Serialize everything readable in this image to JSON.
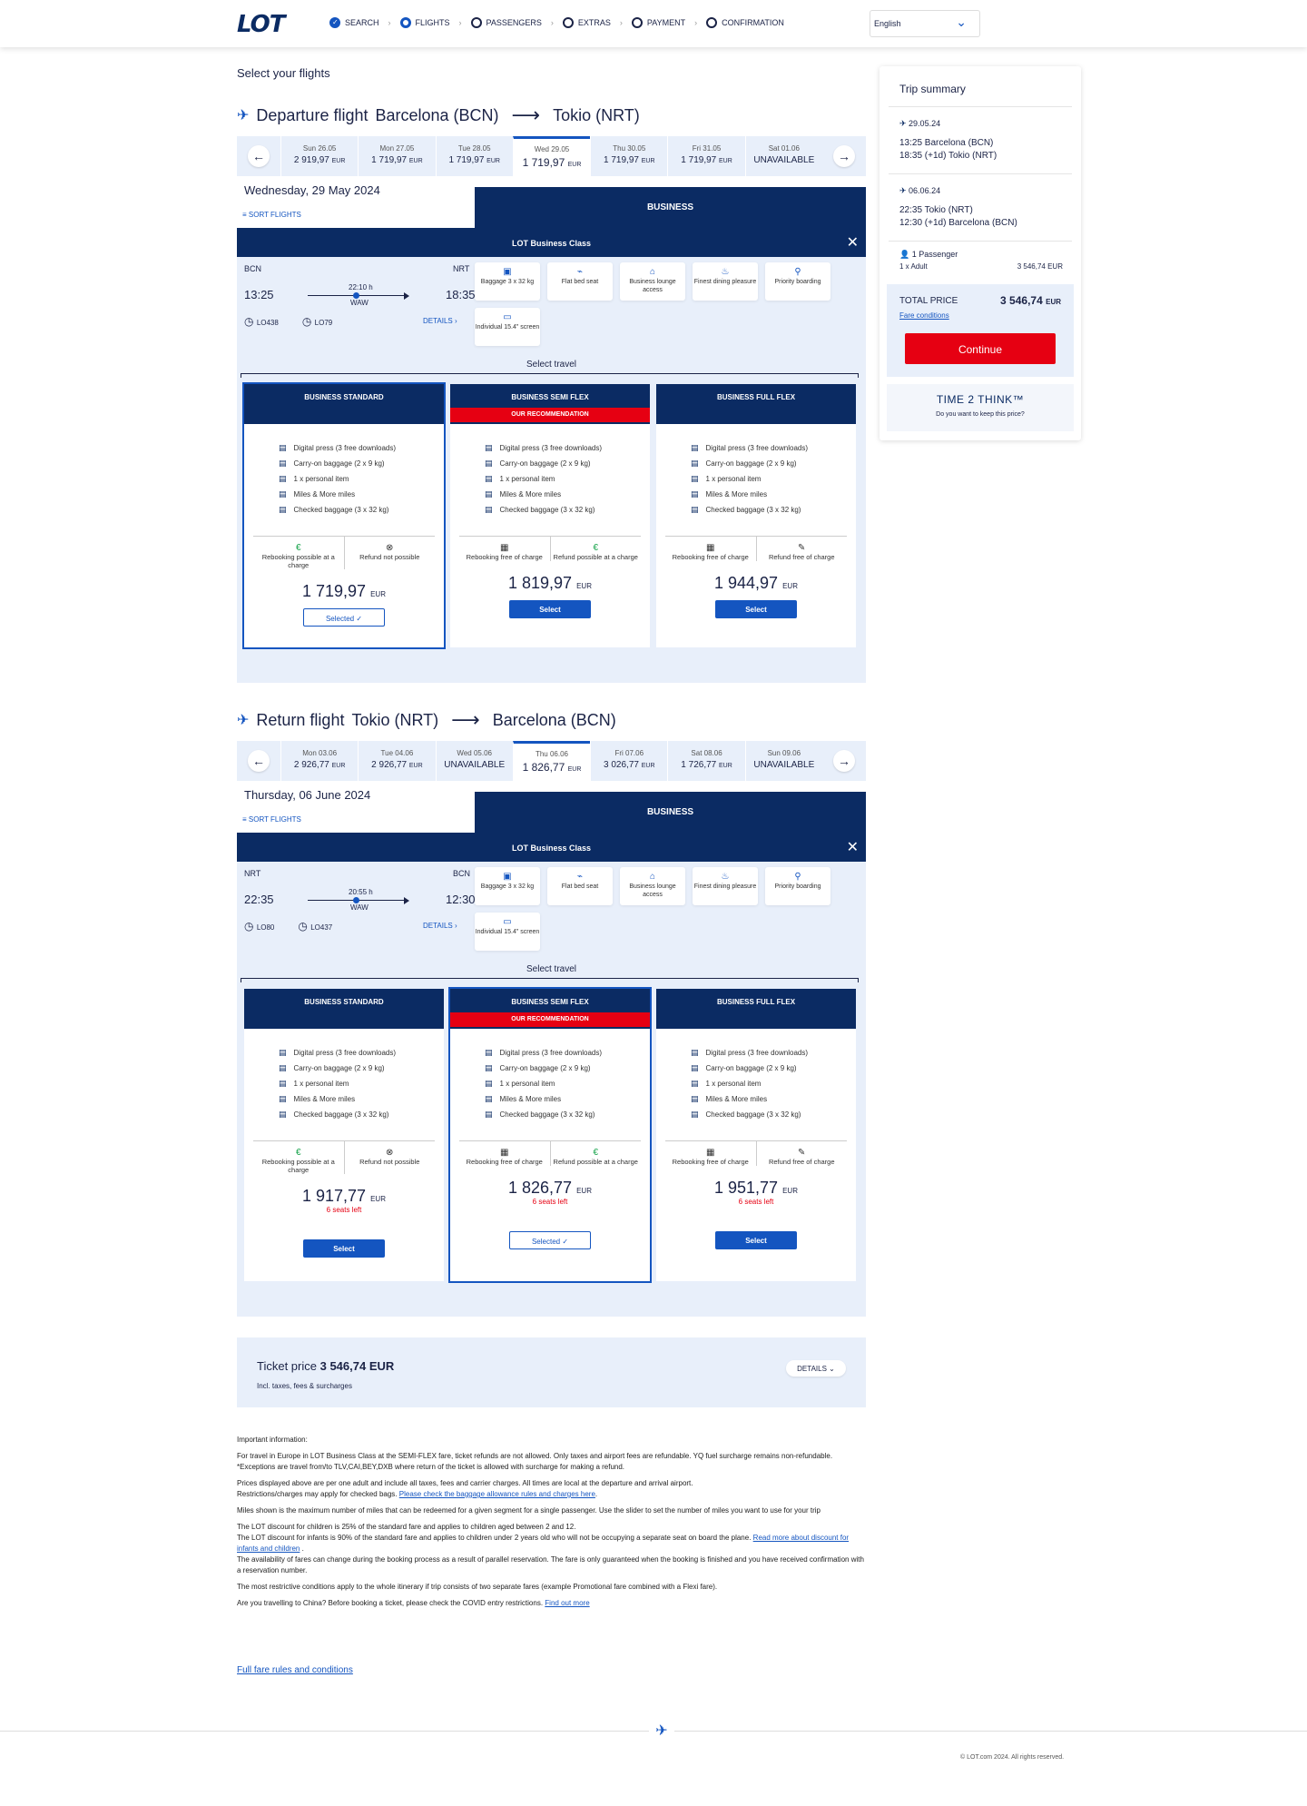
{
  "header": {
    "logo": "LOT",
    "steps": [
      "SEARCH",
      "FLIGHTS",
      "PASSENGERS",
      "EXTRAS",
      "PAYMENT",
      "CONFIRMATION"
    ],
    "language": "English"
  },
  "page_title": "Select your flights",
  "departure": {
    "label": "Departure flight",
    "from": "Barcelona (BCN)",
    "to": "Tokio (NRT)",
    "dates": [
      {
        "d": "Sun 26.05",
        "p": "2 919,97",
        "c": "EUR"
      },
      {
        "d": "Mon 27.05",
        "p": "1 719,97",
        "c": "EUR"
      },
      {
        "d": "Tue 28.05",
        "p": "1 719,97",
        "c": "EUR"
      },
      {
        "d": "Wed 29.05",
        "p": "1 719,97",
        "c": "EUR"
      },
      {
        "d": "Thu 30.05",
        "p": "1 719,97",
        "c": "EUR"
      },
      {
        "d": "Fri 31.05",
        "p": "1 719,97",
        "c": "EUR"
      },
      {
        "d": "Sat 01.06",
        "p": "UNAVAILABLE",
        "c": ""
      }
    ],
    "selected_date": "Wednesday, 29 May 2024",
    "sort": "SORT FLIGHTS",
    "cabin": "BUSINESS",
    "class_title": "LOT Business Class",
    "from_code": "BCN",
    "to_code": "NRT",
    "dep_time": "13:25",
    "arr_time": "18:35",
    "duration": "22:10 h",
    "via": "WAW",
    "flights": [
      "LO438",
      "LO79"
    ],
    "details": "DETAILS ›",
    "features": [
      "Baggage 3 x 32 kg",
      "Flat bed seat",
      "Business lounge access",
      "Finest dining pleasure",
      "Priority boarding",
      "Individual 15.4\" screen"
    ],
    "select_travel": "Select travel",
    "fares": [
      {
        "name": "BUSINESS STANDARD",
        "rec": "",
        "items": [
          "Digital press (3 free downloads)",
          "Carry-on baggage (2 x 9 kg)",
          "1 x personal item",
          "Miles & More miles",
          "Checked baggage (3 x 32 kg)"
        ],
        "rebook": "Rebooking possible at a charge",
        "refund": "Refund not possible",
        "price": "1 719,97",
        "cur": "EUR",
        "seats": "",
        "btn": "Selected ✓"
      },
      {
        "name": "BUSINESS SEMI FLEX",
        "rec": "OUR RECOMMENDATION",
        "items": [
          "Digital press (3 free downloads)",
          "Carry-on baggage (2 x 9 kg)",
          "1 x personal item",
          "Miles & More miles",
          "Checked baggage (3 x 32 kg)"
        ],
        "rebook": "Rebooking free of charge",
        "refund": "Refund possible at a charge",
        "price": "1 819,97",
        "cur": "EUR",
        "seats": "",
        "btn": "Select"
      },
      {
        "name": "BUSINESS FULL FLEX",
        "rec": "",
        "items": [
          "Digital press (3 free downloads)",
          "Carry-on baggage (2 x 9 kg)",
          "1 x personal item",
          "Miles & More miles",
          "Checked baggage (3 x 32 kg)"
        ],
        "rebook": "Rebooking free of charge",
        "refund": "Refund free of charge",
        "price": "1 944,97",
        "cur": "EUR",
        "seats": "",
        "btn": "Select"
      }
    ]
  },
  "return": {
    "label": "Return flight",
    "from": "Tokio (NRT)",
    "to": "Barcelona (BCN)",
    "dates": [
      {
        "d": "Mon 03.06",
        "p": "2 926,77",
        "c": "EUR"
      },
      {
        "d": "Tue 04.06",
        "p": "2 926,77",
        "c": "EUR"
      },
      {
        "d": "Wed 05.06",
        "p": "UNAVAILABLE",
        "c": ""
      },
      {
        "d": "Thu 06.06",
        "p": "1 826,77",
        "c": "EUR"
      },
      {
        "d": "Fri 07.06",
        "p": "3 026,77",
        "c": "EUR"
      },
      {
        "d": "Sat 08.06",
        "p": "1 726,77",
        "c": "EUR"
      },
      {
        "d": "Sun 09.06",
        "p": "UNAVAILABLE",
        "c": ""
      }
    ],
    "selected_date": "Thursday, 06 June 2024",
    "sort": "SORT FLIGHTS",
    "cabin": "BUSINESS",
    "class_title": "LOT Business Class",
    "from_code": "NRT",
    "to_code": "BCN",
    "dep_time": "22:35",
    "arr_time": "12:30",
    "duration": "20:55 h",
    "via": "WAW",
    "flights": [
      "LO80",
      "LO437"
    ],
    "details": "DETAILS ›",
    "features": [
      "Baggage 3 x 32 kg",
      "Flat bed seat",
      "Business lounge access",
      "Finest dining pleasure",
      "Priority boarding",
      "Individual 15.4\" screen"
    ],
    "select_travel": "Select travel",
    "fares": [
      {
        "name": "BUSINESS STANDARD",
        "rec": "",
        "items": [
          "Digital press (3 free downloads)",
          "Carry-on baggage (2 x 9 kg)",
          "1 x personal item",
          "Miles & More miles",
          "Checked baggage (3 x 32 kg)"
        ],
        "rebook": "Rebooking possible at a charge",
        "refund": "Refund not possible",
        "price": "1 917,77",
        "cur": "EUR",
        "seats": "6 seats left",
        "btn": "Select"
      },
      {
        "name": "BUSINESS SEMI FLEX",
        "rec": "OUR RECOMMENDATION",
        "items": [
          "Digital press (3 free downloads)",
          "Carry-on baggage (2 x 9 kg)",
          "1 x personal item",
          "Miles & More miles",
          "Checked baggage (3 x 32 kg)"
        ],
        "rebook": "Rebooking free of charge",
        "refund": "Refund possible at a charge",
        "price": "1 826,77",
        "cur": "EUR",
        "seats": "6 seats left",
        "btn": "Selected ✓"
      },
      {
        "name": "BUSINESS FULL FLEX",
        "rec": "",
        "items": [
          "Digital press (3 free downloads)",
          "Carry-on baggage (2 x 9 kg)",
          "1 x personal item",
          "Miles & More miles",
          "Checked baggage (3 x 32 kg)"
        ],
        "rebook": "Rebooking free of charge",
        "refund": "Refund free of charge",
        "price": "1 951,77",
        "cur": "EUR",
        "seats": "6 seats left",
        "btn": "Select"
      }
    ]
  },
  "ticket": {
    "label": "Ticket price",
    "amount": "3 546,74 EUR",
    "sub": "Incl. taxes, fees & surcharges",
    "details": "DETAILS ⌄"
  },
  "info": {
    "title": "Important information:",
    "p1": "For travel in Europe in LOT Business Class at the SEMI-FLEX fare, ticket refunds are not allowed. Only taxes and airport fees are refundable. YQ fuel surcharge remains non-refundable.",
    "p1b": "*Exceptions are travel from/to TLV,CAI,BEY,DXB where return of the ticket is allowed with surcharge for making a refund.",
    "p2": "Prices displayed above are per one adult and include all taxes, fees and carrier charges. All times are local at the departure and arrival airport.",
    "p2b": "Restrictions/charges may apply for checked bags.",
    "p2link": "Please check the baggage allowance rules and charges here",
    "p3": "Miles shown is the maximum number of miles that can be redeemed for a given segment for a single passenger. Use the slider to set the number of miles you want to use for your trip",
    "p4": "The LOT discount for children is 25% of the standard fare and applies to children aged between 2 and 12.",
    "p4b": "The LOT discount for infants is 90% of the standard fare and applies to children under 2 years old who will not be occupying a separate seat on board the plane.",
    "p4link": "Read more about discount for infants and children",
    "p4c": "The availability of fares can change during the booking process as a result of parallel reservation. The fare is only guaranteed when the booking is finished and you have received confirmation with a reservation number.",
    "p5": "The most restrictive conditions apply to the whole itinerary if trip consists of two separate fares (example Promotional fare combined with a Flexi fare).",
    "p6": "Are you travelling to China? Before booking a ticket, please check the COVID entry restrictions.",
    "p6link": "Find out more",
    "full": "Full fare rules and conditions"
  },
  "footer": {
    "copy": "© LOT.com 2024. All rights reserved."
  },
  "summary": {
    "title": "Trip summary",
    "seg1": {
      "date": "29.05.24",
      "l1": "13:25  Barcelona (BCN)",
      "l2": "18:35  (+1d)  Tokio (NRT)"
    },
    "seg2": {
      "date": "06.06.24",
      "l1": "22:35  Tokio (NRT)",
      "l2": "12:30  (+1d)  Barcelona (BCN)"
    },
    "pax": "1 Passenger",
    "pax_row": "1 x  Adult",
    "pax_price": "3 546,74 EUR",
    "total_label": "TOTAL PRICE",
    "total": "3 546,74",
    "total_cur": "EUR",
    "fare_conditions": "Fare conditions",
    "continue": "Continue",
    "t2t": "TIME 2 THINK™",
    "t2t_q": "Do you want to keep this price?"
  },
  "colors": {
    "navy": "#0b2b63",
    "blue": "#1455c0",
    "red": "#e60012",
    "panel": "#e8effa"
  }
}
